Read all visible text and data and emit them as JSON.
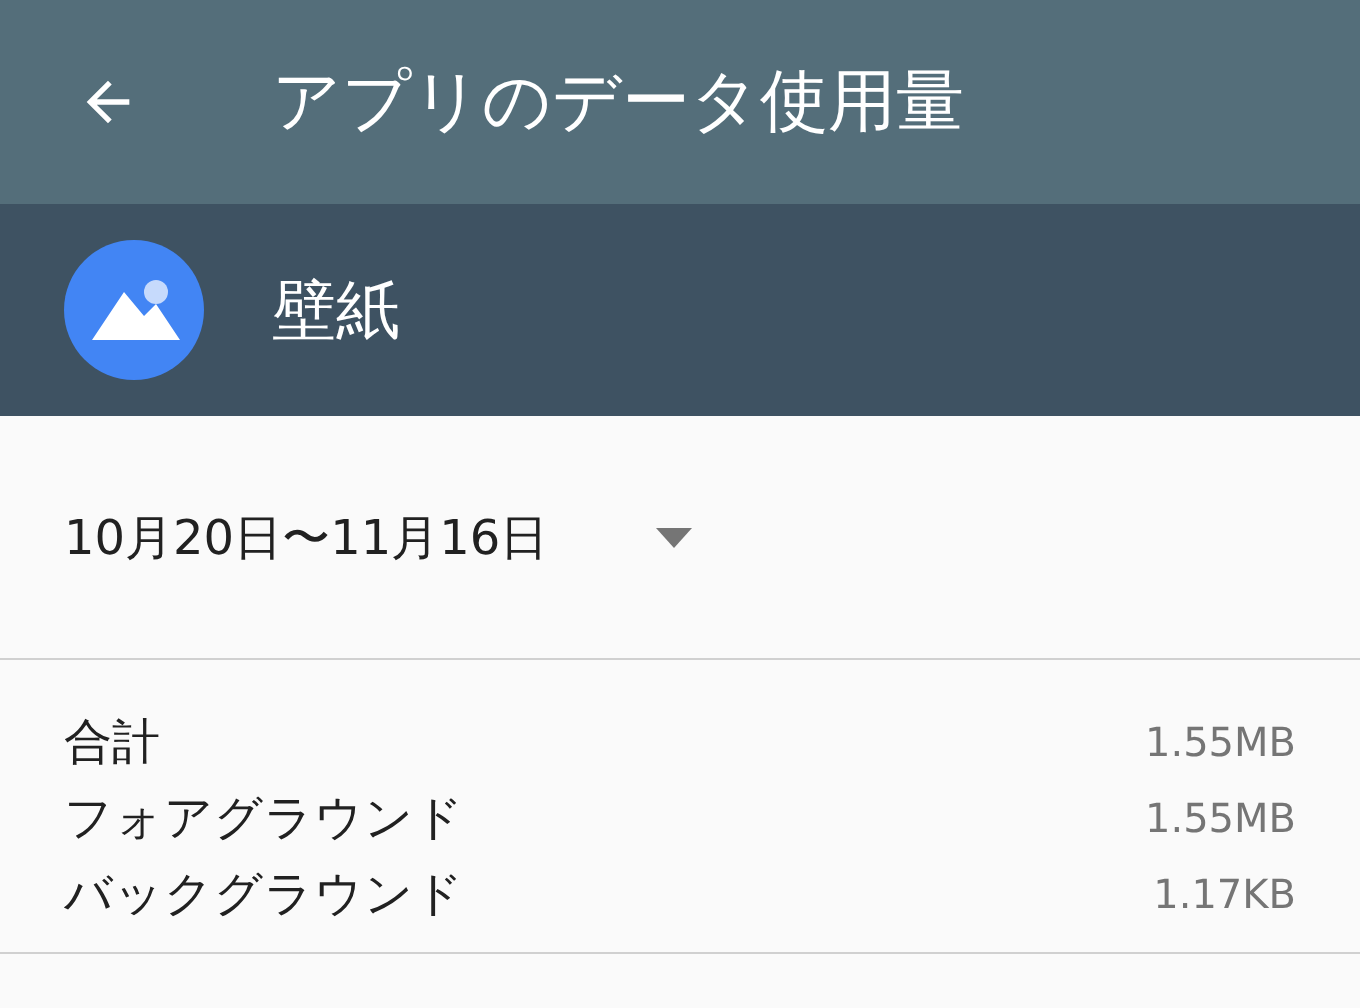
{
  "toolbar": {
    "title": "アプリのデータ使用量"
  },
  "app": {
    "name": "壁紙"
  },
  "date_range": {
    "value": "10月20日〜11月16日"
  },
  "usage": [
    {
      "label": "合計",
      "value": "1.55MB"
    },
    {
      "label": "フォアグラウンド",
      "value": "1.55MB"
    },
    {
      "label": "バックグラウンド",
      "value": "1.17KB"
    }
  ]
}
